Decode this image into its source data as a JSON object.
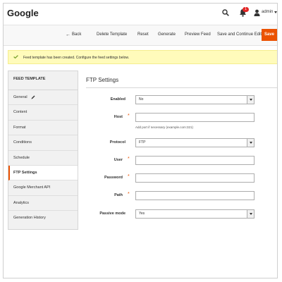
{
  "header": {
    "title": "Google",
    "notification_count": "1",
    "user_name": "admin"
  },
  "actions": {
    "back": "Back",
    "delete": "Delete Template",
    "reset": "Reset",
    "generate": "Generate",
    "preview": "Preview Feed",
    "save_continue": "Save and Continue Edit",
    "save": "Save"
  },
  "message": {
    "text": "Feed template has been created. Configure the feed settings below."
  },
  "sidebar": {
    "heading": "FEED TEMPLATE",
    "items": [
      {
        "label": "General"
      },
      {
        "label": "Content"
      },
      {
        "label": "Format"
      },
      {
        "label": "Conditions"
      },
      {
        "label": "Schedule"
      },
      {
        "label": "FTP Settings"
      },
      {
        "label": "Google Merchant API"
      },
      {
        "label": "Analytics"
      },
      {
        "label": "Generation History"
      }
    ]
  },
  "form": {
    "title": "FTP Settings",
    "enabled": {
      "label": "Enabled",
      "value": "No"
    },
    "host": {
      "label": "Host",
      "value": "",
      "hint": "Add port if necessary (example.com:321)"
    },
    "protocol": {
      "label": "Protocol",
      "value": "FTP"
    },
    "user": {
      "label": "User",
      "value": ""
    },
    "password": {
      "label": "Password",
      "value": ""
    },
    "path": {
      "label": "Path",
      "value": ""
    },
    "passive_mode": {
      "label": "Passive mode",
      "value": "Yes"
    }
  },
  "colors": {
    "accent": "#eb5202",
    "notice_bg": "#fffbbb",
    "badge": "#e22626",
    "success_check": "#79a22e"
  },
  "icons": {
    "search": "search-icon",
    "notifications": "bell-icon",
    "user": "user-icon",
    "back": "arrow-left-icon",
    "edit": "pencil-icon",
    "success": "check-icon"
  }
}
